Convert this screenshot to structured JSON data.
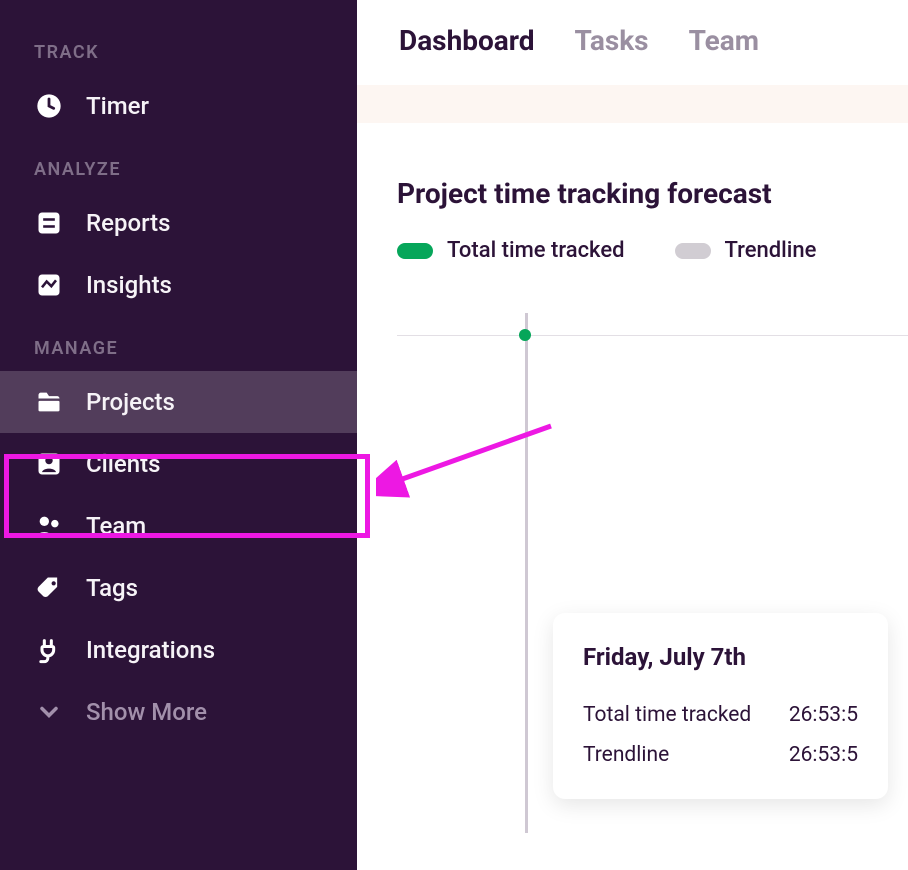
{
  "sidebar": {
    "sections": {
      "track": {
        "header": "TRACK",
        "items": [
          {
            "label": "Timer",
            "icon": "clock-icon",
            "selected": false,
            "dim": false
          }
        ]
      },
      "analyze": {
        "header": "ANALYZE",
        "items": [
          {
            "label": "Reports",
            "icon": "reports-icon",
            "selected": false,
            "dim": false
          },
          {
            "label": "Insights",
            "icon": "insights-icon",
            "selected": false,
            "dim": false
          }
        ]
      },
      "manage": {
        "header": "MANAGE",
        "items": [
          {
            "label": "Projects",
            "icon": "folder-icon",
            "selected": true,
            "dim": false
          },
          {
            "label": "Clients",
            "icon": "client-icon",
            "selected": false,
            "dim": false
          },
          {
            "label": "Team",
            "icon": "team-icon",
            "selected": false,
            "dim": false
          },
          {
            "label": "Tags",
            "icon": "tags-icon",
            "selected": false,
            "dim": false
          },
          {
            "label": "Integrations",
            "icon": "integrations-icon",
            "selected": false,
            "dim": false
          },
          {
            "label": "Show More",
            "icon": "chevron-down-icon",
            "selected": false,
            "dim": true
          }
        ]
      }
    }
  },
  "tabs": [
    {
      "label": "Dashboard",
      "active": true
    },
    {
      "label": "Tasks",
      "active": false
    },
    {
      "label": "Team",
      "active": false
    }
  ],
  "chart": {
    "title": "Project time tracking forecast",
    "legend": [
      {
        "label": "Total time tracked",
        "colorKey": "green"
      },
      {
        "label": "Trendline",
        "colorKey": "grey"
      }
    ]
  },
  "tooltip": {
    "title": "Friday, July 7th",
    "rows": [
      {
        "label": "Total time tracked",
        "value": "26:53:5"
      },
      {
        "label": "Trendline",
        "value": "26:53:5"
      }
    ]
  },
  "annotation": {
    "highlight_target": "sidebar-item-projects",
    "arrow_color": "#ed18e3"
  }
}
